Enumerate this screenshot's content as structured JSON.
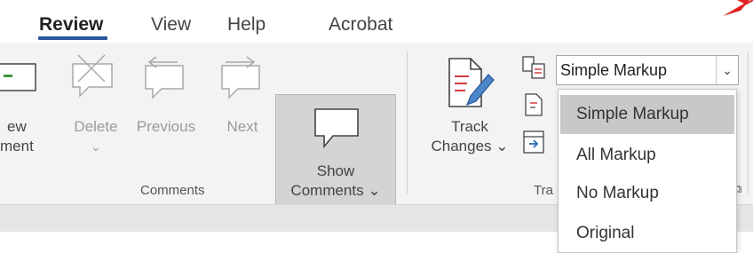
{
  "tabs": [
    {
      "label": "Review",
      "active": true
    },
    {
      "label": "View",
      "active": false
    },
    {
      "label": "Help",
      "active": false
    },
    {
      "label": "Acrobat",
      "active": false
    }
  ],
  "comments_group": {
    "new_comment": {
      "line1": "ew",
      "line2": "ment"
    },
    "delete": {
      "line1": "Delete",
      "line2": "⌄"
    },
    "previous": {
      "line1": "Previous"
    },
    "next": {
      "line1": "Next"
    },
    "show_comments": {
      "line1": "Show",
      "line2": "Comments ⌄"
    },
    "label": "Comments"
  },
  "tracking_group": {
    "track_changes": {
      "line1": "Track",
      "line2": "Changes ⌄"
    },
    "markup_select": {
      "value": "Simple Markup",
      "arrow": "⌄"
    },
    "label": "Tra",
    "launcher": "⧉"
  },
  "markup_dropdown": {
    "options": [
      "Simple Markup",
      "All Markup",
      "No Markup",
      "Original"
    ],
    "selected_index": 0
  },
  "colors": {
    "accent": "#2b579a",
    "annotation_arrow": "#e02020"
  }
}
